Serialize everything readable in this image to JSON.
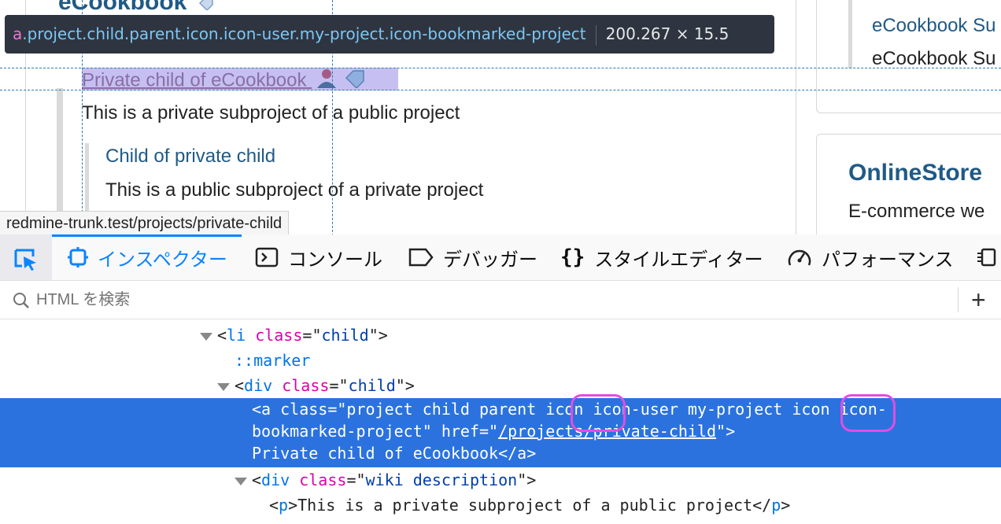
{
  "page": {
    "brand_title": "eCookbook",
    "project_link": "Private child of eCookbook",
    "project_desc": "This is a private subproject of a public project",
    "child_link": "Child of private child",
    "child_desc": "This is a public subproject of a private project",
    "right_card1_link": "eCookbook Su",
    "right_card1_text": "eCookbook Su",
    "right_card2_title": "OnlineStore",
    "right_card2_text": "E-commerce we",
    "status_url": "redmine-trunk.test/projects/private-child"
  },
  "tooltip": {
    "tag": "a",
    "classes": ".project.child.parent.icon.icon-user.my-project.icon-bookmarked-project",
    "dimensions": "200.267 × 15.5"
  },
  "devtools": {
    "tabs": [
      {
        "label": "インスペクター",
        "icon": "inspector-icon",
        "active": true
      },
      {
        "label": "コンソール",
        "icon": "console-icon"
      },
      {
        "label": "デバッガー",
        "icon": "debugger-icon"
      },
      {
        "label": "スタイルエディター",
        "icon": "style-editor-icon"
      },
      {
        "label": "パフォーマンス",
        "icon": "performance-icon"
      }
    ],
    "search_placeholder": "HTML を検索",
    "add_label": "+",
    "colors": {
      "accent": "#0a84ff",
      "selection": "#2b72de",
      "annotation": "#e24de0"
    },
    "tree": {
      "li_tag": "li",
      "li_class": "child",
      "marker": "::marker",
      "div_tag": "div",
      "div_class": "child",
      "a_line1_pre": "<a class=\"project child parent ",
      "a_icon1": "icon",
      "a_line1_mid": " icon-user my-project ",
      "a_icon2": "icon",
      "a_line1_post": " icon-",
      "a_line2_pre": "bookmarked-project\" href=\"",
      "a_href": "/projects/private-child",
      "a_line2_post": "\">",
      "a_line3": "Private child of eCookbook</a>",
      "wiki_div_class": "wiki description",
      "p_text": "This is a private subproject of a public project"
    }
  }
}
